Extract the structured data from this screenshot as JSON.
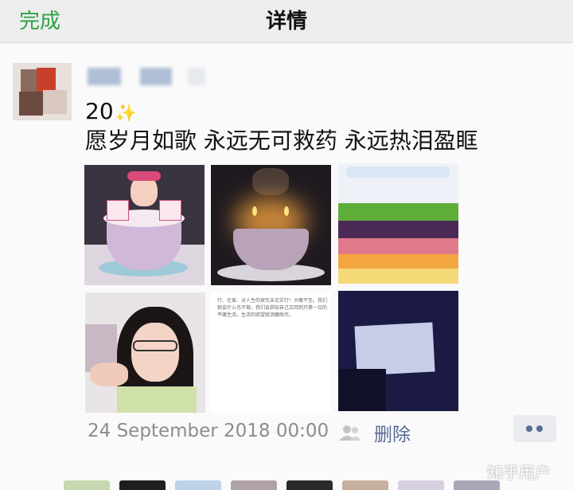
{
  "navbar": {
    "done_label": "完成",
    "title": "详情"
  },
  "post": {
    "line1": "20",
    "sparkle": "✨",
    "line2": "愿岁月如歌  永远无可救药  永远热泪盈眶",
    "photos": [
      "photo-1",
      "photo-2",
      "photo-3",
      "photo-4",
      "photo-5",
      "photo-6"
    ],
    "photo5_text": "行、在爱、对人生的探究未见实行！大概不至。我们就会什么也不做，我们会获知自己又回到只第一日的平庸生活。生活的欲望就消磨殆尽。",
    "timestamp": "24 September 2018 00:00",
    "delete_label": "删除",
    "privacy_icon": "people-icon",
    "more_icon": "more-dots-icon"
  },
  "watermark": "知乎用户",
  "colors": {
    "accent_green": "#2ba245",
    "link_blue": "#576b95",
    "meta_gray": "#8c8c8c"
  }
}
